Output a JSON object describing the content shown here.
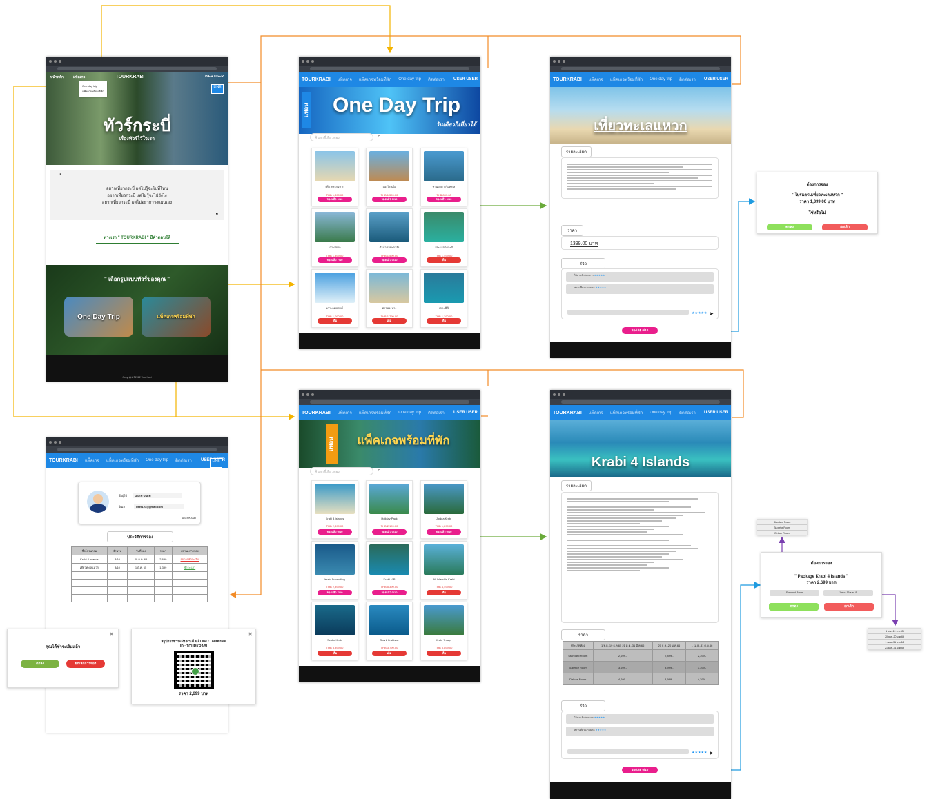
{
  "home": {
    "nav": [
      "หน้าหลัก",
      "แพ็คเกจ",
      "TOURKRABI",
      "USER USER"
    ],
    "dropdown": [
      "One day trip",
      "แพ็คเกจพร้อมที่พัก"
    ],
    "hero_title": "ทัวร์กระบี่",
    "hero_sub": "เรื่องทัวร์ไว้ใจเรา",
    "quote": [
      "อยากเที่ยวกระบี่ แต่ไม่รู้จะไปที่ไหน",
      "อยากเที่ยวกระบี่ แต่ไม่รู้จะไปยังไง",
      "อยากเที่ยวกระบี่ แต่ไม่อยากวางแผนเอง"
    ],
    "cta": "ทางเรา \" TOURKRABI \" มีคำตอบให้",
    "choose": "\" เลือกรูปแบบทัวร์ของคุณ \"",
    "opt1": "One Day Trip",
    "opt2": "แพ็คเกจพร้อมที่พัก",
    "copyright": "Copyright ©2022 TourKrabi"
  },
  "oneday": {
    "logo": "TOURKRABI",
    "nav": [
      "แพ็คเกจ",
      "แพ็คเกจพร้อมที่พัก",
      "One day trip",
      "ติดต่อเรา"
    ],
    "user": "USER USER",
    "plan": "แพลน",
    "title": "One Day Trip",
    "sub": "วันเดียวก็เที่ยวได้",
    "search": "ค้นหาที่เที่ยวท่อง",
    "cards": [
      {
        "n": "เที่ยวทะเลแหวก",
        "p": "THB 1,399.00",
        "b": "จองแล้ว 0/10"
      },
      {
        "n": "ล่องโรงเรือ",
        "p": "THB 1,599.00",
        "b": "จองแล้ว 0/10"
      },
      {
        "n": "ทานอาหารริมทะเล",
        "p": "THB 899.00",
        "b": "จองแล้ว 0/10"
      },
      {
        "n": "เกาะปอดะ",
        "p": "THB 1,399.00",
        "b": "จองแล้ว 7/10"
      },
      {
        "n": "ดำน้ำชมปะการัง",
        "p": "THB 1,599.00",
        "b": "จองแล้ว 0/10"
      },
      {
        "n": "สระมรกตกระบี่",
        "p": "THB 1,499.00",
        "b": "เต็ม"
      },
      {
        "n": "เกาะลอยเกยก์",
        "p": "THB 1,090.00",
        "b": "เต็ม"
      },
      {
        "n": "อ่าวพระนาง",
        "p": "THB 1,799.00",
        "b": "เต็ม"
      },
      {
        "n": "เกาะพีพี",
        "p": "THB 1,290.00",
        "b": "เต็ม"
      }
    ]
  },
  "pkg": {
    "plan": "แพลน",
    "title": "แพ็คเกจพร้อมที่พัก",
    "search": "ค้นหาที่เที่ยวท่อง",
    "cards": [
      {
        "n": "Krabi 4 Islands",
        "p": "THB 2,399.00",
        "b": "จองแล้ว 0/10"
      },
      {
        "n": "Holiday Pack",
        "p": "THB 2,199.00",
        "b": "จองแล้ว 0/10"
      },
      {
        "n": "Jonkla Krabi",
        "p": "THB 1,299.00",
        "b": "จองแล้ว 0/10"
      },
      {
        "n": "Krabi Snorkeling",
        "p": "THB 2,399.00",
        "b": "จองแล้ว 7/10"
      },
      {
        "n": "Krabi VIP",
        "p": "THB 5,399.00",
        "b": "จองแล้ว 0/10"
      },
      {
        "n": "All Island in Krabi",
        "p": "THB 4,499.00",
        "b": "เต็ม"
      },
      {
        "n": "Scuba Krabi",
        "p": "THB 3,399.00",
        "b": "เต็ม"
      },
      {
        "n": "Shark Krabisue",
        "p": "THB 3,799.00",
        "b": "เต็ม"
      },
      {
        "n": "Krabi 7 days",
        "p": "THB 5,899.00",
        "b": "เต็ม"
      }
    ]
  },
  "detail1": {
    "title": "เที่ยวทะเลแหวก",
    "detail_h": "รายละเอียด",
    "price_h": "ราคา",
    "price": "1399.00 บาท",
    "review_h": "รีวิว",
    "reviews": [
      "ไปมาแล้วสนุกมาก",
      "สถานที่สวยงามมาก"
    ],
    "stars": "★★★★★",
    "book": "จองเลย 0/10"
  },
  "detail2": {
    "title": "Krabi 4 Islands",
    "detail_h": "รายละเอียด",
    "price_h": "ราคา",
    "table_head": [
      "ประเภทห้อง",
      "1 พ.ย.-19 ธ.ค.65 21 ม.ค.-31 มี.ค.66",
      "20 ธ.ค.-20 ม.ค.66",
      "1 เม.ย.-31 ต.ค.66"
    ],
    "rows": [
      [
        "Standard Room",
        "2,699.-",
        "2,899.-",
        "2,399.-"
      ],
      [
        "Superior Room",
        "3,699.-",
        "3,999.-",
        "3,399.-"
      ],
      [
        "Deluxe Room",
        "4,690.-",
        "4,999.-",
        "4,399.-"
      ]
    ],
    "review_h": "รีวิว",
    "reviews": [
      "ไปมาแล้วสนุกมาก",
      "สถานที่สวยงามมาก"
    ],
    "stars": "★★★★★",
    "book": "จองเลย 0/10"
  },
  "confirm1": {
    "h": "ต้องการจอง",
    "name": "\" โปรแกรมเที่ยวทะเลแหวก \"",
    "price": "ราคา 1,399.00 บาท",
    "q": "ใช่หรือไม่",
    "yes": "ตกลง",
    "no": "ยกเลิก"
  },
  "confirm2": {
    "h": "ต้องการจอง",
    "name": "\" Package Krabi 4 Islands \"",
    "price": "ราคา 2,699 บาท",
    "sel1": "Standard Room",
    "sel2": "1 พ.ย.-19 ธ.ค.65",
    "yes": "ตกลง",
    "no": "ยกเลิก"
  },
  "room_opts": [
    "Standard Room",
    "Superior Room",
    "Deluxe Room"
  ],
  "date_opts": [
    "1 พ.ย.-19 ธ.ค.65",
    "20 ธ.ค.-20 ม.ค.66",
    "1 เม.ย.-31 ต.ค.66",
    "21 ม.ค.-31 มี.ค.66"
  ],
  "profile": {
    "name_l": "ชื่อผู้ใช้ :",
    "name": "USER USER",
    "mail_l": "อีเมล :",
    "mail": "user123@gmail.com",
    "edit": "USERKRABI",
    "hist": "ประวัติการจอง",
    "cols": [
      "ชื่อโปรแกรม",
      "จำนวน",
      "วันที่จอง",
      "ราคา",
      "สถานะการจอง"
    ],
    "rows": [
      [
        "Krabi 4 Islands",
        "8/10",
        "20 ก.ค. 65",
        "2,699",
        "รอการชำระเงิน"
      ],
      [
        "เที่ยวทะเลแหวก",
        "8/10",
        "1 ต.ค. 65",
        "1,399",
        "ชำระแล้ว"
      ]
    ]
  },
  "paid": {
    "h": "คุณได้ชำระเงินแล้ว",
    "ok": "ตกลง",
    "cancel": "ยกเลิกการจอง"
  },
  "pay": {
    "h": "สรุปการชำระเงินผ่านไลน์ Line / TourKrabi",
    "id": "ID : TOURKRABI",
    "price": "ราคา 2,699 บาท"
  }
}
